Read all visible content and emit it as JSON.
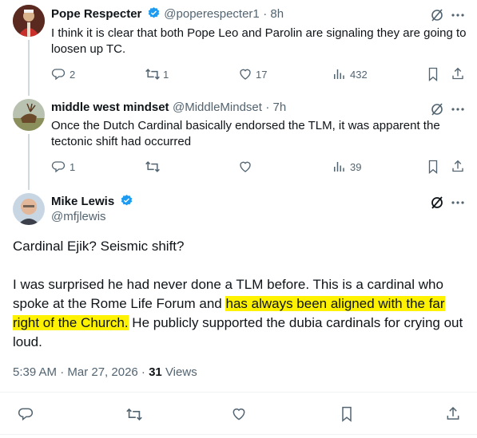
{
  "reply1": {
    "name": "Pope Respecter",
    "handle": "@poperespecter1",
    "time": "· 8h",
    "text": "I think it is clear that both Pope Leo and Parolin are signaling they are going to loosen up TC.",
    "replies": "2",
    "reposts": "1",
    "likes": "17",
    "views": "432"
  },
  "reply2": {
    "name": "middle west mindset",
    "handle": "@MiddleMindset",
    "time": "· 7h",
    "text": "Once the Dutch Cardinal basically endorsed the TLM, it was apparent the tectonic shift had occurred",
    "replies": "1",
    "reposts": "",
    "likes": "",
    "views": "39"
  },
  "main": {
    "name": "Mike Lewis",
    "handle": "@mfjlewis",
    "para1": "Cardinal Ejik? Seismic shift?",
    "para2_pre": "I was surprised he had never done a TLM before. This is a cardinal who spoke at the Rome Life Forum and ",
    "para2_hl1": "has always been aligned with the far",
    "para2_hl2": "right of the Church.",
    "para2_post": " He publicly supported the dubia cardinals for crying out loud.",
    "timestamp": "5:39 AM · Mar 27, 2026 · ",
    "views_count": "31",
    "views_label": " Views"
  },
  "colors": {
    "text": "#0f1419",
    "secondary": "#536471",
    "verified": "#1d9bf0",
    "highlight": "#fff200"
  }
}
